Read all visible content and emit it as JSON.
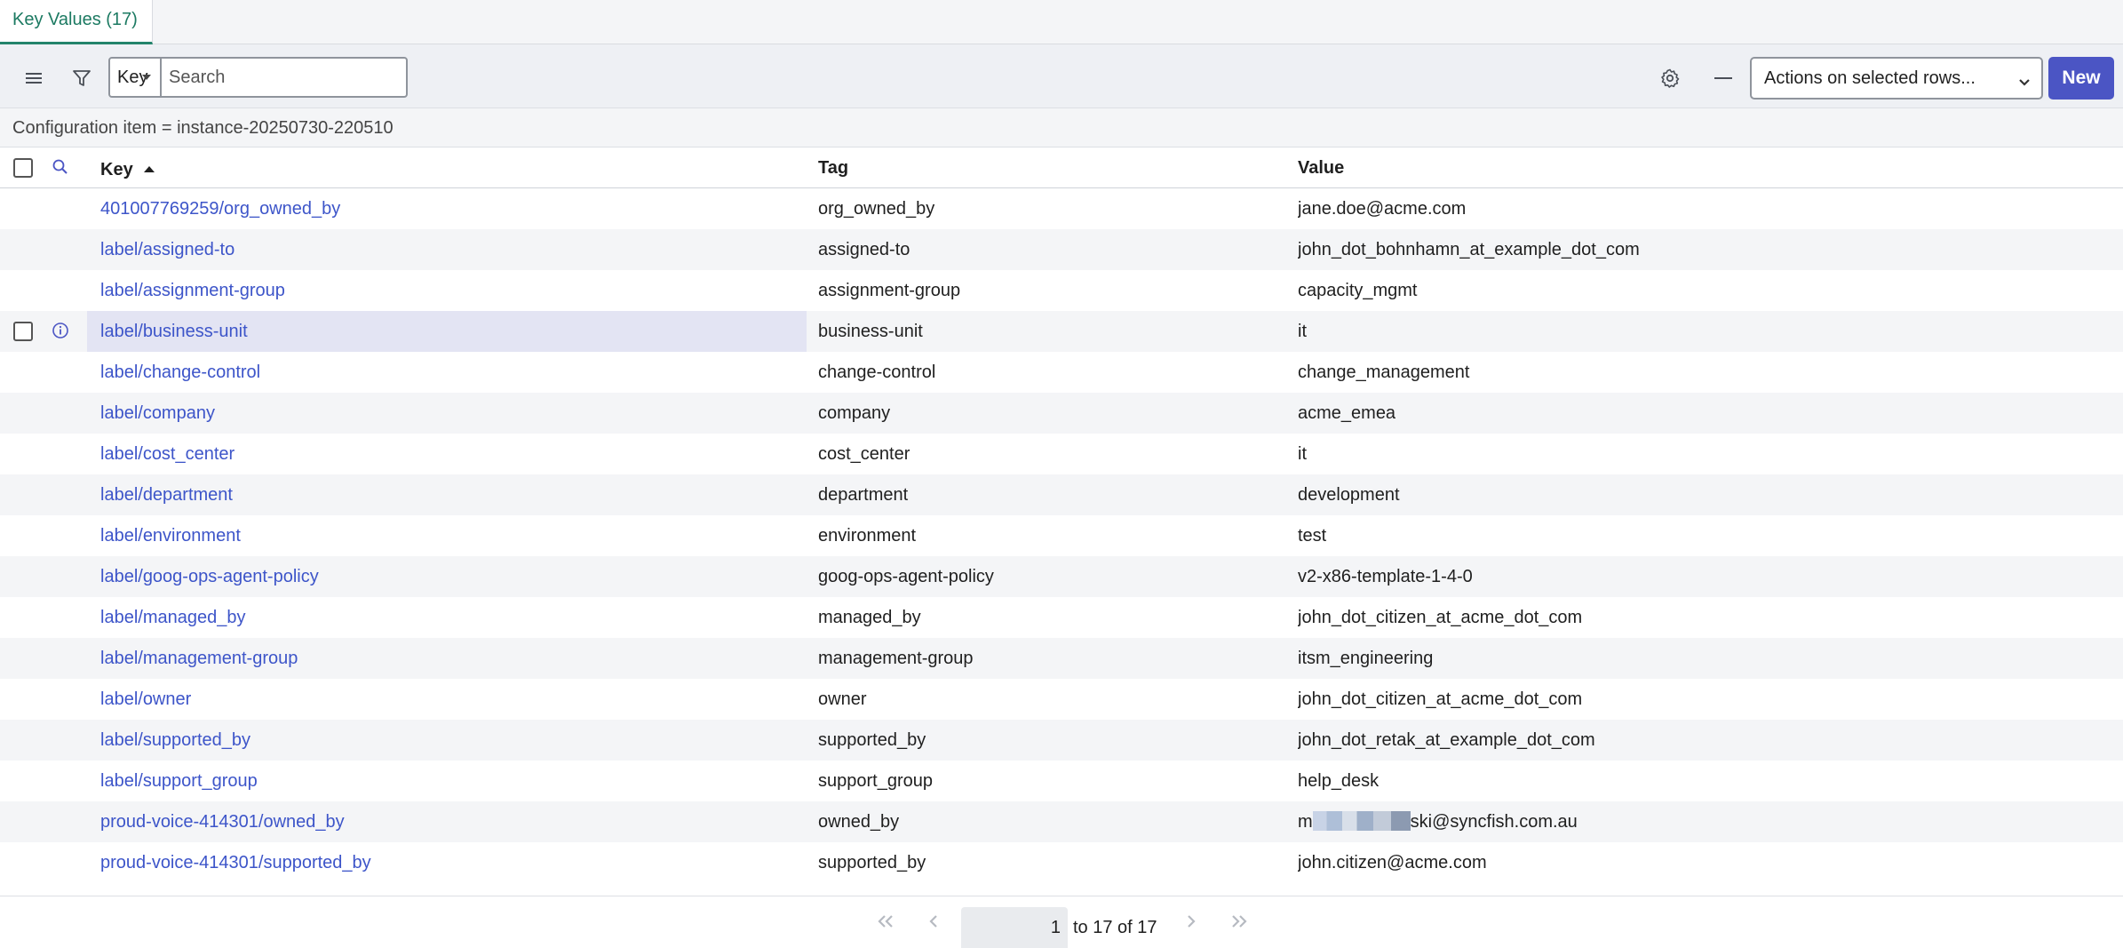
{
  "tab": {
    "label": "Key Values (17)"
  },
  "toolbar": {
    "search_field": "Key",
    "search_placeholder": "Search",
    "actions_label": "Actions on selected rows...",
    "new_label": "New"
  },
  "breadcrumb": "Configuration item = instance-20250730-220510",
  "table": {
    "headers": {
      "key": "Key",
      "tag": "Tag",
      "value": "Value"
    },
    "rows": [
      {
        "key": "401007769259/org_owned_by",
        "tag": "org_owned_by",
        "value": "jane.doe@acme.com"
      },
      {
        "key": "label/assigned-to",
        "tag": "assigned-to",
        "value": "john_dot_bohnhamn_at_example_dot_com"
      },
      {
        "key": "label/assignment-group",
        "tag": "assignment-group",
        "value": "capacity_mgmt"
      },
      {
        "key": "label/business-unit",
        "tag": "business-unit",
        "value": "it"
      },
      {
        "key": "label/change-control",
        "tag": "change-control",
        "value": "change_management"
      },
      {
        "key": "label/company",
        "tag": "company",
        "value": "acme_emea"
      },
      {
        "key": "label/cost_center",
        "tag": "cost_center",
        "value": "it"
      },
      {
        "key": "label/department",
        "tag": "department",
        "value": "development"
      },
      {
        "key": "label/environment",
        "tag": "environment",
        "value": "test"
      },
      {
        "key": "label/goog-ops-agent-policy",
        "tag": "goog-ops-agent-policy",
        "value": "v2-x86-template-1-4-0"
      },
      {
        "key": "label/managed_by",
        "tag": "managed_by",
        "value": "john_dot_citizen_at_acme_dot_com"
      },
      {
        "key": "label/management-group",
        "tag": "management-group",
        "value": "itsm_engineering"
      },
      {
        "key": "label/owner",
        "tag": "owner",
        "value": "john_dot_citizen_at_acme_dot_com"
      },
      {
        "key": "label/supported_by",
        "tag": "supported_by",
        "value": "john_dot_retak_at_example_dot_com"
      },
      {
        "key": "label/support_group",
        "tag": "support_group",
        "value": "help_desk"
      },
      {
        "key": "proud-voice-414301/owned_by",
        "tag": "owned_by",
        "value_prefix": "m",
        "value_suffix": "ski@syncfish.com.au"
      },
      {
        "key": "proud-voice-414301/supported_by",
        "tag": "supported_by",
        "value": "john.citizen@acme.com"
      }
    ]
  },
  "pagination": {
    "current_page": "1",
    "range_text": "to 17 of 17"
  }
}
